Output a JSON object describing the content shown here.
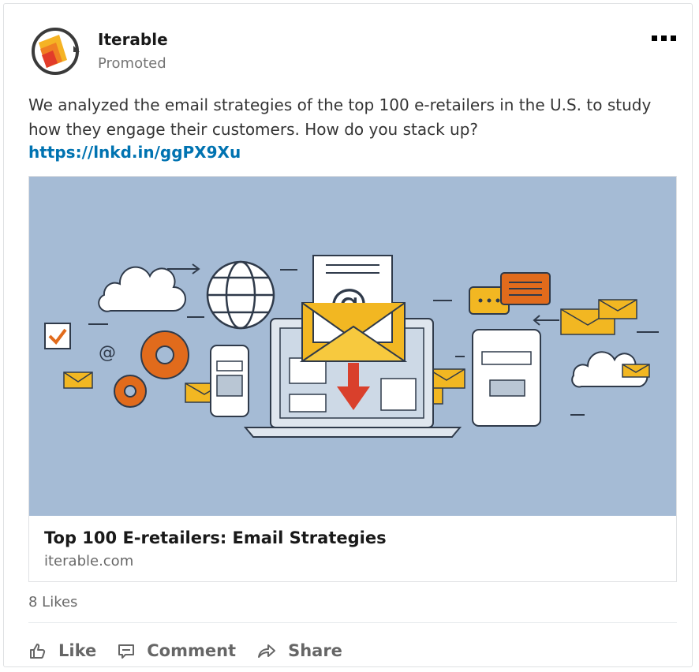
{
  "post": {
    "company_name": "Iterable",
    "promoted_label": "Promoted",
    "body_text": "We analyzed the email strategies of the top 100 e-retailers in the U.S. to study how they engage their customers. How do you stack up?",
    "link_text": "https://lnkd.in/ggPX9Xu"
  },
  "article": {
    "title": "Top 100 E-retailers: Email Strategies",
    "domain": "iterable.com",
    "image_text": "@"
  },
  "social": {
    "likes_label": "8 Likes"
  },
  "actions": {
    "like_label": "Like",
    "comment_label": "Comment",
    "share_label": "Share"
  },
  "icons": {
    "more": "more-icon",
    "like": "thumbs-up-icon",
    "comment": "comment-icon",
    "share": "share-arrow-icon"
  },
  "colors": {
    "link": "#0073b1",
    "image_background": "#a5bbd5",
    "accent_yellow": "#f2b722",
    "accent_orange": "#e16b1c"
  }
}
